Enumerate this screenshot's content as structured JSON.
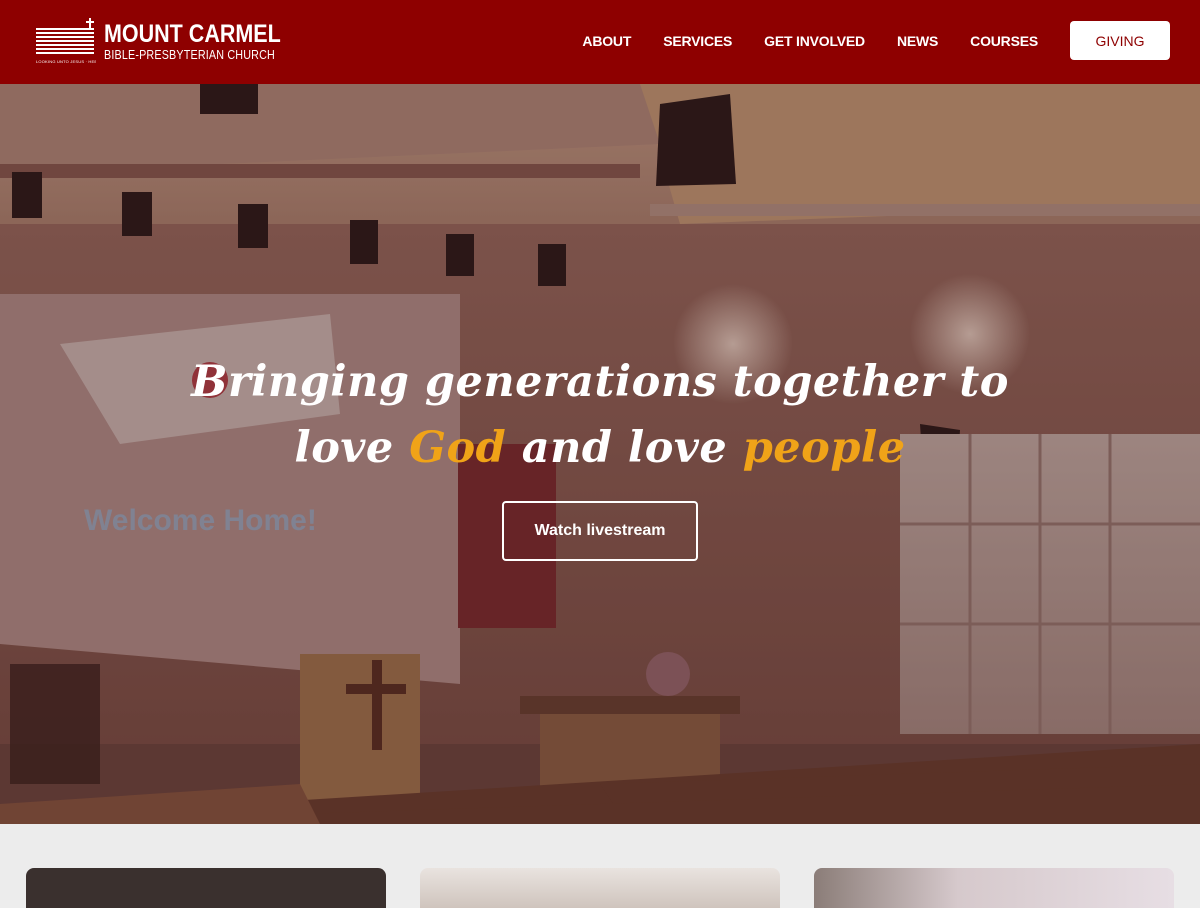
{
  "brand": {
    "name": "MOUNT CARMEL",
    "subtitle": "BIBLE-PRESBYTERIAN CHURCH",
    "tagline": "LOOKING UNTO JESUS · HEB 12:2"
  },
  "nav": {
    "items": [
      "ABOUT",
      "SERVICES",
      "GET INVOLVED",
      "NEWS",
      "COURSES"
    ],
    "giving_label": "GIVING"
  },
  "hero": {
    "line1": "Bringing generations together to",
    "line2_a": "love",
    "line2_b": "God",
    "line2_c": "and love",
    "line2_d": "people",
    "cta_label": "Watch livestream",
    "screen_text": "Welcome Home!"
  },
  "colors": {
    "brand_red": "#8e0000",
    "accent_orange": "#f0a318"
  }
}
